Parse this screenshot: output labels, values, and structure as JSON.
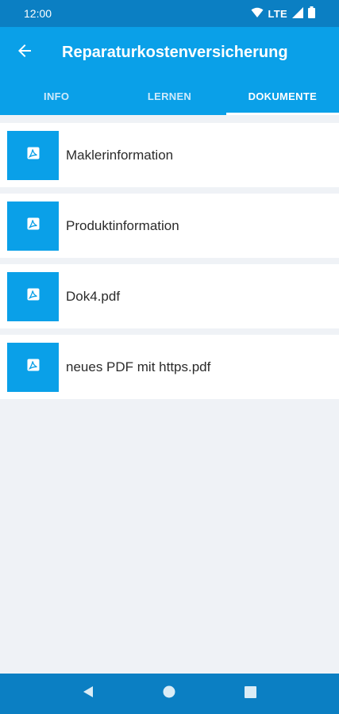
{
  "status_bar": {
    "time": "12:00",
    "network": "LTE",
    "icons": [
      "wifi-icon",
      "signal-icon",
      "battery-icon"
    ]
  },
  "app_bar": {
    "back_icon": "arrow-left-icon",
    "title": "Reparaturkostenversicherung"
  },
  "tabs": [
    {
      "label": "INFO",
      "active": false
    },
    {
      "label": "LERNEN",
      "active": false
    },
    {
      "label": "DOKUMENTE",
      "active": true
    }
  ],
  "documents": [
    {
      "name": "Maklerinformation",
      "icon": "pdf-icon"
    },
    {
      "name": "Produktinformation",
      "icon": "pdf-icon"
    },
    {
      "name": "Dok4.pdf",
      "icon": "pdf-icon"
    },
    {
      "name": "neues PDF mit https.pdf",
      "icon": "pdf-icon"
    }
  ],
  "nav_bar": {
    "buttons": [
      "back-triangle-icon",
      "home-circle-icon",
      "recents-square-icon"
    ]
  },
  "colors": {
    "status_bar": "#0b7fc3",
    "primary": "#0aa0e8",
    "background": "#eff2f6",
    "text": "#2b2b2b"
  }
}
